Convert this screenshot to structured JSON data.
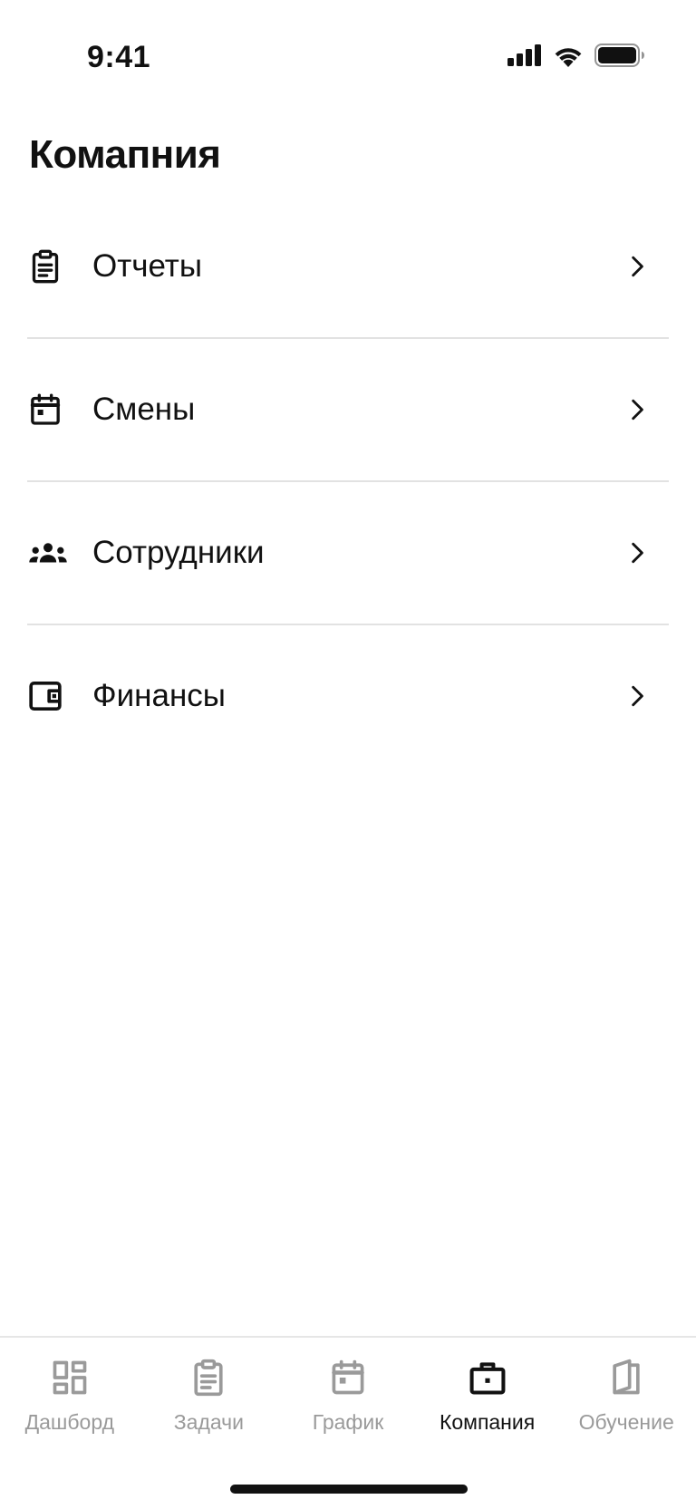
{
  "status_bar": {
    "time": "9:41",
    "icons": [
      "cellular-signal-icon",
      "wifi-icon",
      "battery-icon"
    ]
  },
  "page": {
    "title": "Комапния"
  },
  "menu": {
    "items": [
      {
        "label": "Отчеты",
        "icon": "clipboard-icon"
      },
      {
        "label": "Смены",
        "icon": "calendar-icon"
      },
      {
        "label": "Сотрудники",
        "icon": "people-icon"
      },
      {
        "label": "Финансы",
        "icon": "wallet-icon"
      }
    ],
    "chevron_icon": "chevron-right-icon"
  },
  "tab_bar": {
    "active": "Компания",
    "colors": {
      "active": "#111111",
      "inactive": "#9a9a9a"
    },
    "tabs": [
      {
        "label": "Дашборд",
        "icon": "dashboard-icon"
      },
      {
        "label": "Задачи",
        "icon": "clipboard-icon"
      },
      {
        "label": "График",
        "icon": "calendar-icon"
      },
      {
        "label": "Компания",
        "icon": "briefcase-icon"
      },
      {
        "label": "Обучение",
        "icon": "book-icon"
      }
    ]
  }
}
